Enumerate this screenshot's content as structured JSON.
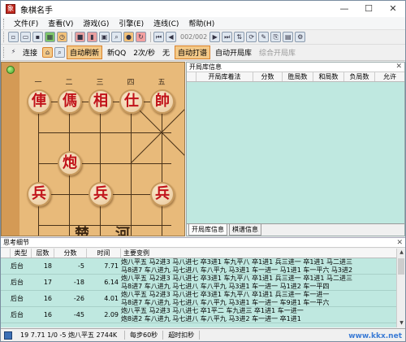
{
  "window": {
    "title": "象棋名手",
    "app_icon": "chinese-chess-app-icon",
    "controls": [
      "—",
      "☐",
      "✕"
    ]
  },
  "menu": [
    {
      "label": "文件(F)"
    },
    {
      "label": "查看(V)"
    },
    {
      "label": "游戏(G)"
    },
    {
      "label": "引擎(E)"
    },
    {
      "label": "连线(C)"
    },
    {
      "label": "帮助(H)"
    }
  ],
  "toolbar1": {
    "icons": [
      "new-icon",
      "open-icon",
      "save-icon",
      "board-icon",
      "timer-icon",
      "red-icon",
      "red-flag-icon",
      "monitor-icon",
      "search-icon",
      "stop-icon",
      "refresh-icon"
    ],
    "nav_icons": [
      "first-icon",
      "prev-icon"
    ],
    "move_counter": "002/002",
    "nav_icons_after": [
      "next-icon",
      "last-icon",
      "flip-icon",
      "rotate-icon",
      "tool-icon",
      "copy-icon",
      "paste-icon",
      "settings-icon"
    ]
  },
  "toolbar2": {
    "connect_label": "连接",
    "auto_refresh_label": "自动刷新",
    "new_qq_label": "新QQ",
    "frequency_label": "2次/秒",
    "none_label": "无",
    "auto_play_label": "自动打谱",
    "auto_library_label": "自动开局库",
    "combined_library_label": "综合开局库"
  },
  "board": {
    "file_labels": [
      "一",
      "二",
      "三",
      "四",
      "五"
    ],
    "pieces": [
      {
        "char": "俥",
        "side": "red"
      },
      {
        "char": "傌",
        "side": "red"
      },
      {
        "char": "相",
        "side": "red"
      },
      {
        "char": "仕",
        "side": "red"
      },
      {
        "char": "帥",
        "side": "red"
      },
      {
        "char": "炮",
        "side": "red"
      },
      {
        "char": "兵",
        "side": "red"
      },
      {
        "char": "兵",
        "side": "red"
      },
      {
        "char": "兵",
        "side": "red"
      }
    ],
    "river_text": [
      "楚",
      "河"
    ]
  },
  "opening_library": {
    "title": "开局库信息",
    "columns": [
      "开局库着法",
      "分数",
      "胜局数",
      "和局数",
      "负局数",
      "允许"
    ],
    "tabs": [
      "开局库信息",
      "棋谱信息"
    ]
  },
  "analysis": {
    "title": "思考细节",
    "columns": [
      "类型",
      "层数",
      "分数",
      "时间",
      "主要变例"
    ],
    "rows": [
      {
        "type": "后台",
        "depth": "18",
        "score": "-5",
        "time": "7.71",
        "pv1": "炮八平五 马2进3 马八进七 卒3进1 车九平八 卒1进1 兵三进一 卒1进1 马二进三",
        "pv2": "马8进7 车八进九 马七进八 车八平九 马3进1 车一进一 马1进1 车一平六 马3进2"
      },
      {
        "type": "后台",
        "depth": "17",
        "score": "-18",
        "time": "6.14",
        "pv1": "炮八平五 马2进3 马八进七 卒3进1 车九平八 卒1进1 兵三进一 卒1进1 马二进三",
        "pv2": "马8进7 车八进九 马七进八 车八平九 马3进1 车一进一 马1进2 车一平四"
      },
      {
        "type": "后台",
        "depth": "16",
        "score": "-26",
        "time": "4.01",
        "pv1": "炮八平五 马2进3 马八进七 卒3进1 车九平八 卒1进1 兵三进一 车一进一",
        "pv2": "马8进7 车八进九 马七进八 车八平九 马3进1 车一进一 车9进1 车一平六"
      },
      {
        "type": "后台",
        "depth": "16",
        "score": "-45",
        "time": "2.09",
        "pv1": "炮八平五 马2进3 马八进七 卒1平二 车九进三 卒1进1 车一进一",
        "pv2": "炮8进2 车八进九 马七进八 车八平九 马3进2 车一进一 卒1进1"
      }
    ]
  },
  "statusbar": {
    "engine_status": "19 7.71 1/0 -5 炮八平五 2744K",
    "step_time": "每步60秒",
    "timeout": "超时扣秒",
    "watermark": "www.kkx.net"
  }
}
